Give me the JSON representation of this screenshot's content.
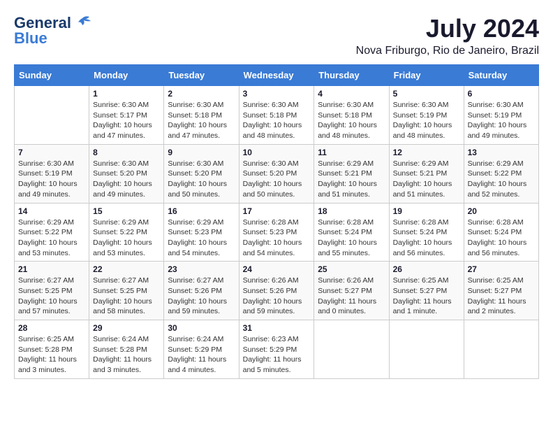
{
  "logo": {
    "general": "General",
    "blue": "Blue"
  },
  "title": "July 2024",
  "subtitle": "Nova Friburgo, Rio de Janeiro, Brazil",
  "days_of_week": [
    "Sunday",
    "Monday",
    "Tuesday",
    "Wednesday",
    "Thursday",
    "Friday",
    "Saturday"
  ],
  "weeks": [
    [
      {
        "day": "",
        "info": ""
      },
      {
        "day": "1",
        "info": "Sunrise: 6:30 AM\nSunset: 5:17 PM\nDaylight: 10 hours\nand 47 minutes."
      },
      {
        "day": "2",
        "info": "Sunrise: 6:30 AM\nSunset: 5:18 PM\nDaylight: 10 hours\nand 47 minutes."
      },
      {
        "day": "3",
        "info": "Sunrise: 6:30 AM\nSunset: 5:18 PM\nDaylight: 10 hours\nand 48 minutes."
      },
      {
        "day": "4",
        "info": "Sunrise: 6:30 AM\nSunset: 5:18 PM\nDaylight: 10 hours\nand 48 minutes."
      },
      {
        "day": "5",
        "info": "Sunrise: 6:30 AM\nSunset: 5:19 PM\nDaylight: 10 hours\nand 48 minutes."
      },
      {
        "day": "6",
        "info": "Sunrise: 6:30 AM\nSunset: 5:19 PM\nDaylight: 10 hours\nand 49 minutes."
      }
    ],
    [
      {
        "day": "7",
        "info": "Sunrise: 6:30 AM\nSunset: 5:19 PM\nDaylight: 10 hours\nand 49 minutes."
      },
      {
        "day": "8",
        "info": "Sunrise: 6:30 AM\nSunset: 5:20 PM\nDaylight: 10 hours\nand 49 minutes."
      },
      {
        "day": "9",
        "info": "Sunrise: 6:30 AM\nSunset: 5:20 PM\nDaylight: 10 hours\nand 50 minutes."
      },
      {
        "day": "10",
        "info": "Sunrise: 6:30 AM\nSunset: 5:20 PM\nDaylight: 10 hours\nand 50 minutes."
      },
      {
        "day": "11",
        "info": "Sunrise: 6:29 AM\nSunset: 5:21 PM\nDaylight: 10 hours\nand 51 minutes."
      },
      {
        "day": "12",
        "info": "Sunrise: 6:29 AM\nSunset: 5:21 PM\nDaylight: 10 hours\nand 51 minutes."
      },
      {
        "day": "13",
        "info": "Sunrise: 6:29 AM\nSunset: 5:22 PM\nDaylight: 10 hours\nand 52 minutes."
      }
    ],
    [
      {
        "day": "14",
        "info": "Sunrise: 6:29 AM\nSunset: 5:22 PM\nDaylight: 10 hours\nand 53 minutes."
      },
      {
        "day": "15",
        "info": "Sunrise: 6:29 AM\nSunset: 5:22 PM\nDaylight: 10 hours\nand 53 minutes."
      },
      {
        "day": "16",
        "info": "Sunrise: 6:29 AM\nSunset: 5:23 PM\nDaylight: 10 hours\nand 54 minutes."
      },
      {
        "day": "17",
        "info": "Sunrise: 6:28 AM\nSunset: 5:23 PM\nDaylight: 10 hours\nand 54 minutes."
      },
      {
        "day": "18",
        "info": "Sunrise: 6:28 AM\nSunset: 5:24 PM\nDaylight: 10 hours\nand 55 minutes."
      },
      {
        "day": "19",
        "info": "Sunrise: 6:28 AM\nSunset: 5:24 PM\nDaylight: 10 hours\nand 56 minutes."
      },
      {
        "day": "20",
        "info": "Sunrise: 6:28 AM\nSunset: 5:24 PM\nDaylight: 10 hours\nand 56 minutes."
      }
    ],
    [
      {
        "day": "21",
        "info": "Sunrise: 6:27 AM\nSunset: 5:25 PM\nDaylight: 10 hours\nand 57 minutes."
      },
      {
        "day": "22",
        "info": "Sunrise: 6:27 AM\nSunset: 5:25 PM\nDaylight: 10 hours\nand 58 minutes."
      },
      {
        "day": "23",
        "info": "Sunrise: 6:27 AM\nSunset: 5:26 PM\nDaylight: 10 hours\nand 59 minutes."
      },
      {
        "day": "24",
        "info": "Sunrise: 6:26 AM\nSunset: 5:26 PM\nDaylight: 10 hours\nand 59 minutes."
      },
      {
        "day": "25",
        "info": "Sunrise: 6:26 AM\nSunset: 5:27 PM\nDaylight: 11 hours\nand 0 minutes."
      },
      {
        "day": "26",
        "info": "Sunrise: 6:25 AM\nSunset: 5:27 PM\nDaylight: 11 hours\nand 1 minute."
      },
      {
        "day": "27",
        "info": "Sunrise: 6:25 AM\nSunset: 5:27 PM\nDaylight: 11 hours\nand 2 minutes."
      }
    ],
    [
      {
        "day": "28",
        "info": "Sunrise: 6:25 AM\nSunset: 5:28 PM\nDaylight: 11 hours\nand 3 minutes."
      },
      {
        "day": "29",
        "info": "Sunrise: 6:24 AM\nSunset: 5:28 PM\nDaylight: 11 hours\nand 3 minutes."
      },
      {
        "day": "30",
        "info": "Sunrise: 6:24 AM\nSunset: 5:29 PM\nDaylight: 11 hours\nand 4 minutes."
      },
      {
        "day": "31",
        "info": "Sunrise: 6:23 AM\nSunset: 5:29 PM\nDaylight: 11 hours\nand 5 minutes."
      },
      {
        "day": "",
        "info": ""
      },
      {
        "day": "",
        "info": ""
      },
      {
        "day": "",
        "info": ""
      }
    ]
  ]
}
